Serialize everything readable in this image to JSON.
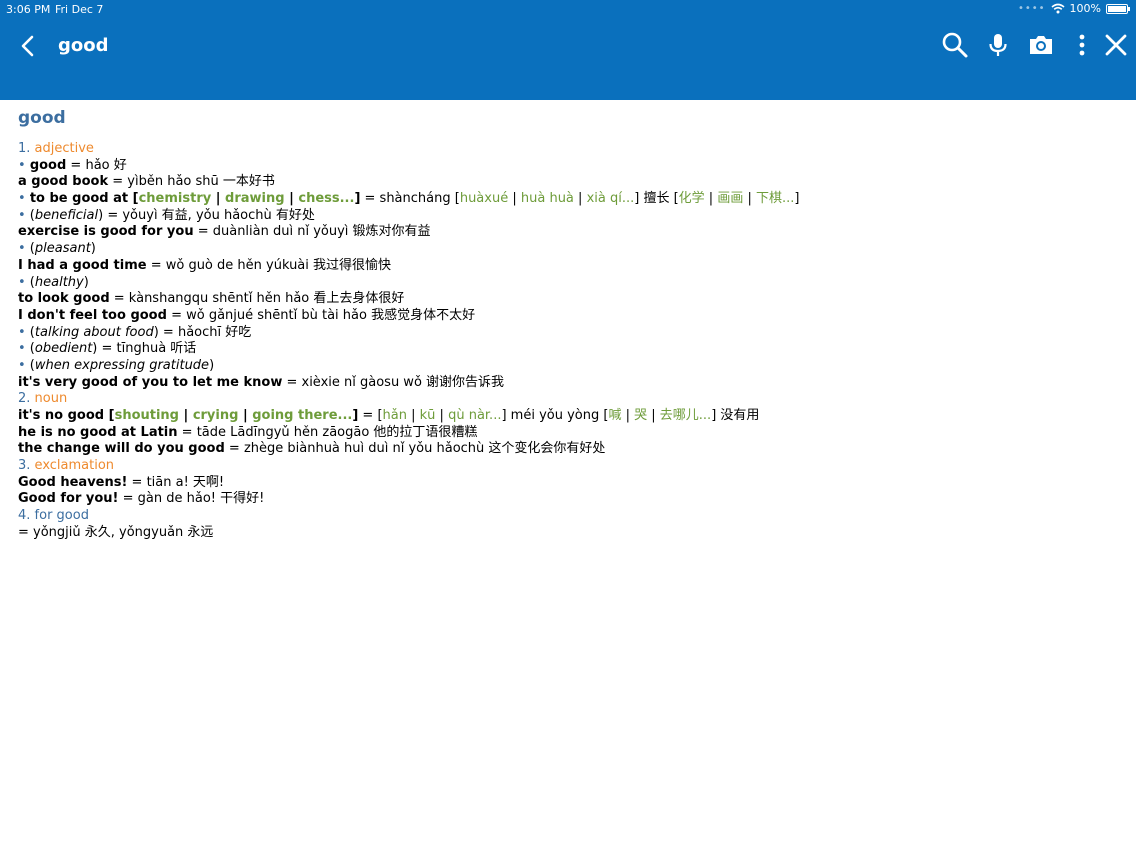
{
  "status": {
    "time": "3:06 PM",
    "date": "Fri Dec 7",
    "battery": "100%",
    "battery_level": 1.0
  },
  "header": {
    "query": "good"
  },
  "colors": {
    "header_bg": "#0a70bd",
    "headword": "#3c6ea0",
    "pos": "#ee8a2e",
    "alt": "#6e9c3a"
  },
  "icons": [
    "back-chevron-icon",
    "search-icon",
    "microphone-icon",
    "camera-icon",
    "more-vertical-icon",
    "close-icon"
  ],
  "entry": {
    "headword": "good",
    "l1": {
      "num": "1.",
      "pos": "adjective"
    },
    "l2": {
      "bul": "•",
      "b": "good",
      "t": " = hǎo 好"
    },
    "l3": {
      "b": "a good book",
      "t": " = yìběn hǎo shū 一本好书"
    },
    "l4": {
      "bul": "•",
      "b": "to be good at",
      "o1": " [",
      "g1": "chemistry",
      "s1": " | ",
      "g2": "drawing",
      "s2": " | ",
      "g3": "chess...",
      "o2": "]",
      "t": " = shàncháng [",
      "h1": "huàxué",
      "s3": " | ",
      "h2": "huà huà",
      "s4": " | ",
      "h3": "xià qí...",
      "t2": "] 擅长 [",
      "c1": "化学",
      "s5": " | ",
      "c2": "画画",
      "s6": " | ",
      "c3": "下棋...",
      "t3": "]"
    },
    "l5": {
      "bul": "•",
      "p1": " (",
      "i": "beneficial",
      "p2": ")",
      "t": " = yǒuyì 有益, yǒu hǎochù 有好处"
    },
    "l6": {
      "b": "exercise is good for you",
      "t": " = duànliàn duì nǐ yǒuyì 锻炼对你有益"
    },
    "l7": {
      "bul": "•",
      "p1": " (",
      "i": "pleasant",
      "p2": ")"
    },
    "l8": {
      "b": "I had a good time",
      "t": " = wǒ guò de hěn yúkuài 我过得很愉快"
    },
    "l9": {
      "bul": "•",
      "p1": " (",
      "i": "healthy",
      "p2": ")"
    },
    "l10": {
      "b": "to look good",
      "t": " = kànshangqu shēntǐ hěn hǎo 看上去身体很好"
    },
    "l11": {
      "b": "I don't feel too good",
      "t": " = wǒ gǎnjué shēntǐ bù tài hǎo 我感觉身体不太好"
    },
    "l12": {
      "bul": "•",
      "p1": " (",
      "i": "talking about food",
      "p2": ")",
      "t": " = hǎochī 好吃"
    },
    "l13": {
      "bul": "•",
      "p1": " (",
      "i": "obedient",
      "p2": ")",
      "t": " = tīnghuà 听话"
    },
    "l14": {
      "bul": "•",
      "p1": " (",
      "i": "when expressing gratitude",
      "p2": ")"
    },
    "l15": {
      "b": "it's very good of you to let me know",
      "t": " = xièxie nǐ gàosu wǒ 谢谢你告诉我"
    },
    "l16": {
      "num": "2.",
      "pos": "noun"
    },
    "l17": {
      "b": "it's no good",
      "o1": " [",
      "g1": "shouting",
      "s1": " | ",
      "g2": "crying",
      "s2": " | ",
      "g3": "going there...",
      "o2": "]",
      "t": " = [",
      "h1": "hǎn",
      "s3": " | ",
      "h2": "kū",
      "s4": " | ",
      "h3": "qù nàr...",
      "t2": "] méi yǒu yòng [",
      "c1": "喊",
      "s5": " | ",
      "c2": "哭",
      "s6": " | ",
      "c3": "去哪儿...",
      "t3": "] 没有用"
    },
    "l18": {
      "b": "he is no good at Latin",
      "t": " = tāde Lādīngyǔ hěn zāogāo 他的拉丁语很糟糕"
    },
    "l19": {
      "b": "the change will do you good",
      "t": " = zhège biànhuà huì duì nǐ yǒu hǎochù 这个变化会你有好处"
    },
    "l20": {
      "num": "3.",
      "pos": "exclamation"
    },
    "l21": {
      "b": "Good heavens!",
      "t": " = tiān a! 天啊!"
    },
    "l22": {
      "b": "Good for you!",
      "t": " = gàn de hǎo! 干得好!"
    },
    "l23": {
      "num": "4.",
      "pos": "for good"
    },
    "l24": {
      "t": "= yǒngjiǔ 永久, yǒngyuǎn 永远"
    }
  }
}
